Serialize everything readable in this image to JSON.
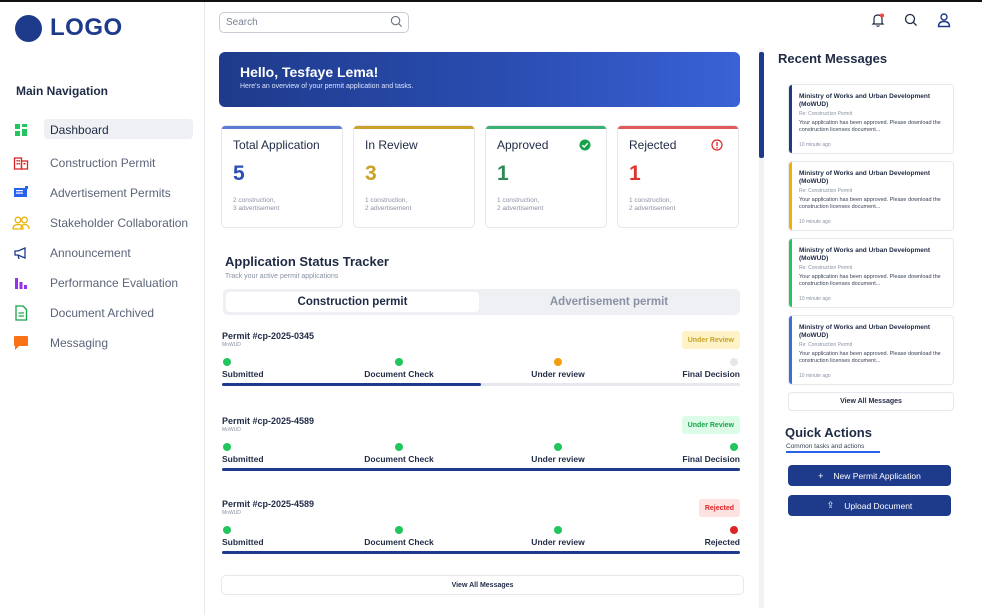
{
  "brand": {
    "logo_text": "LOGO"
  },
  "header": {
    "search_placeholder": "Search",
    "icons": [
      "bell-icon",
      "search-icon",
      "user-icon"
    ]
  },
  "nav": {
    "title": "Main Navigation",
    "items": [
      {
        "label": "Dashboard",
        "icon": "dashboard-icon",
        "color": "#22c55e",
        "active": true
      },
      {
        "label": "Construction Permit",
        "icon": "building-icon",
        "color": "#dc2626"
      },
      {
        "label": "Advertisement Permits",
        "icon": "billboard-icon",
        "color": "#2563eb"
      },
      {
        "label": "Stakeholder Collaboration",
        "icon": "users-icon",
        "color": "#eab308"
      },
      {
        "label": "Announcement",
        "icon": "megaphone-icon",
        "color": "#1e3a8a"
      },
      {
        "label": "Performance Evaluation",
        "icon": "bar-chart-icon",
        "color": "#9333ea"
      },
      {
        "label": "Document Archived",
        "icon": "document-icon",
        "color": "#16a34a"
      },
      {
        "label": "Messaging",
        "icon": "chat-icon",
        "color": "#f97316"
      }
    ]
  },
  "hero": {
    "greeting": "Hello, Tesfaye Lema!",
    "subtitle": "Here's an overview of your permit application and tasks."
  },
  "stats": [
    {
      "title": "Total Application",
      "value": "5",
      "sub1": "2 construction,",
      "sub2": "3 advertisement",
      "color": "#5b7bd5",
      "value_color": "#2b4fb5"
    },
    {
      "title": "In Review",
      "value": "3",
      "sub1": "1 construction,",
      "sub2": "2 advertisement",
      "color": "#c9a227",
      "value_color": "#c9a227"
    },
    {
      "title": "Approved",
      "value": "1",
      "sub1": "1 construction,",
      "sub2": "2 advertisement",
      "color": "#3bb273",
      "value_color": "#2e8b57",
      "icon": "check-circle-icon"
    },
    {
      "title": "Rejected",
      "value": "1",
      "sub1": "1 construction,",
      "sub2": "2 advertisement",
      "color": "#e05a5a",
      "value_color": "#d93636",
      "icon": "alert-circle-icon"
    }
  ],
  "tracker": {
    "title": "Application Status Tracker",
    "subtitle": "Track your active permit applications",
    "tabs": [
      "Construction permit",
      "Advertisement permit"
    ],
    "active_tab": 0,
    "permits": [
      {
        "id": "Permit #cp-2025-0345",
        "org": "MoWUD",
        "badge": "Under Review",
        "badge_bg": "#fdf3c7",
        "badge_fg": "#c9a227",
        "steps": [
          "Submitted",
          "Document Check",
          "Under review",
          "Final Decision"
        ],
        "dot_colors": [
          "#22c55e",
          "#22c55e",
          "#f59e0b",
          "#e5e7eb"
        ],
        "progress": 0.5
      },
      {
        "id": "Permit #cp-2025-4589",
        "org": "MoWUD",
        "badge": "Under Review",
        "badge_bg": "#dcfce7",
        "badge_fg": "#16a34a",
        "steps": [
          "Submitted",
          "Document Check",
          "Under review",
          "Final Decision"
        ],
        "dot_colors": [
          "#22c55e",
          "#22c55e",
          "#22c55e",
          "#22c55e"
        ],
        "progress": 1.0
      },
      {
        "id": "Permit #cp-2025-4589",
        "org": "MoWUD",
        "badge": "Rejected",
        "badge_bg": "#fde2e2",
        "badge_fg": "#dc2626",
        "steps": [
          "Submitted",
          "Document Check",
          "Under review",
          "Rejected"
        ],
        "dot_colors": [
          "#22c55e",
          "#22c55e",
          "#22c55e",
          "#dc2626"
        ],
        "progress": 1.0
      }
    ],
    "view_all": "View All Messages"
  },
  "messages": {
    "title": "Recent Messages",
    "items": [
      {
        "sender": "Ministry of Works and Urban Development (MoWUD)",
        "re": "Re: Construction Permit",
        "body": "Your application has been approved. Please download the construction licenses document...",
        "time": "10 minute ago",
        "accent": "#1e3a8a"
      },
      {
        "sender": "Ministry of Works and Urban Development (MoWUD)",
        "re": "Re: Construction Permit",
        "body": "Your application has been approved. Please download the construction licenses document...",
        "time": "10 minute ago",
        "accent": "#eab308"
      },
      {
        "sender": "Ministry of Works and Urban Development (MoWUD)",
        "re": "Re: Construction Permit",
        "body": "Your application has been approved. Please download the construction licenses document...",
        "time": "10 minute ago",
        "accent": "#22c55e"
      },
      {
        "sender": "Ministry of Works and Urban Development (MoWUD)",
        "re": "Re: Construction Permit",
        "body": "Your application has been approved. Please download the construction licenses document...",
        "time": "10 minute ago",
        "accent": "#3b6fd8"
      }
    ],
    "view_all": "View All Messages"
  },
  "quick_actions": {
    "title": "Quick Actions",
    "subtitle": "Common tasks and actions",
    "buttons": [
      {
        "label": "New Permit Application",
        "icon": "plus-icon",
        "glyph": "+"
      },
      {
        "label": "Upload Document",
        "icon": "upload-icon",
        "glyph": "⇪"
      }
    ]
  }
}
